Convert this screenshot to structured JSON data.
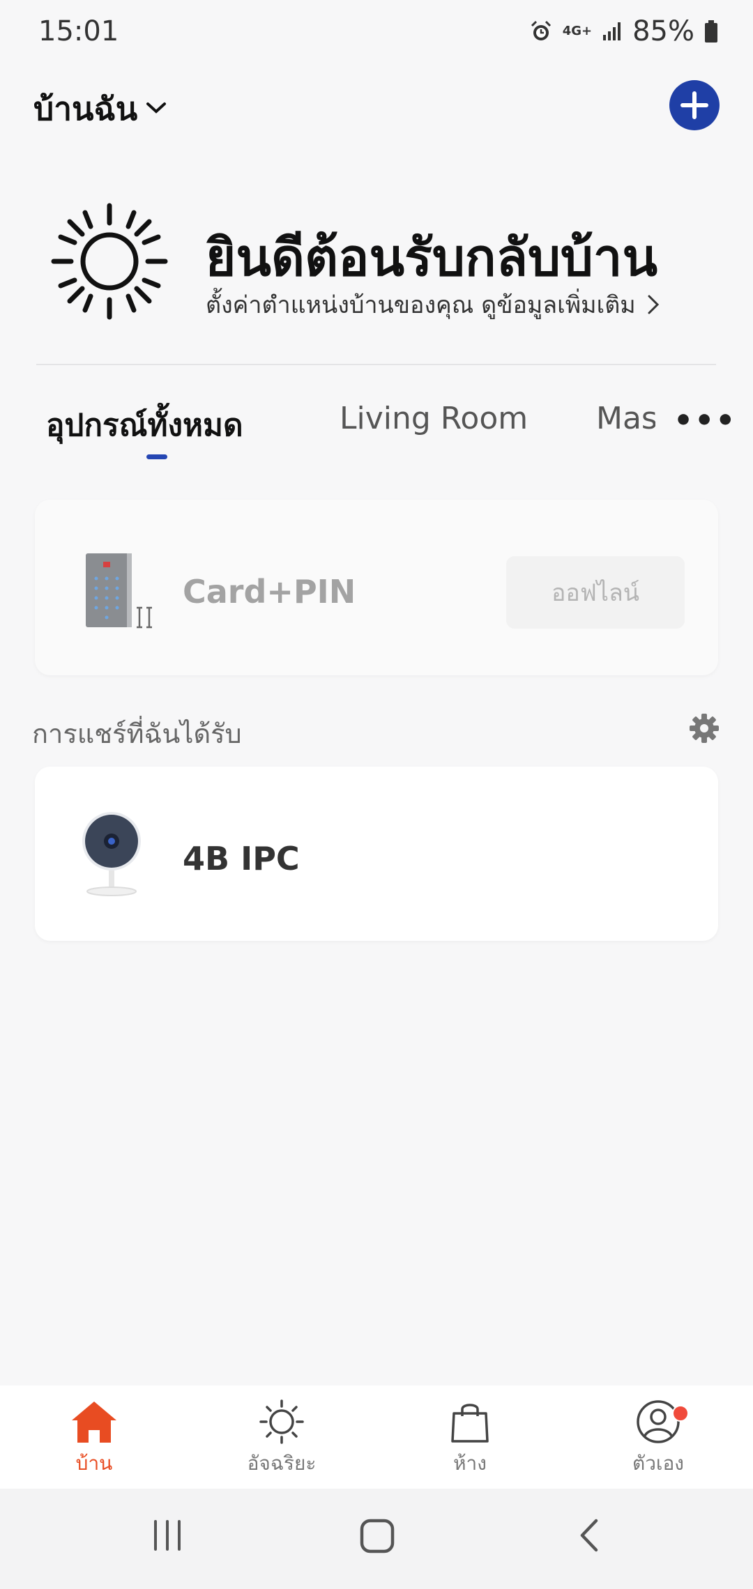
{
  "status_bar": {
    "time": "15:01",
    "network": "4G+",
    "battery": "85%",
    "icons": [
      "alarm-icon",
      "network-4g-icon",
      "signal-icon",
      "battery-icon"
    ]
  },
  "header": {
    "home_name": "บ้านฉัน",
    "add_icon": "plus-icon"
  },
  "welcome": {
    "title": "ยินดีต้อนรับกลับบ้าน",
    "subtitle": "ตั้งค่าตำแหน่งบ้านของคุณ ดูข้อมูลเพิ่มเติม"
  },
  "tabs": {
    "items": [
      {
        "label": "อุปกรณ์ทั้งหมด",
        "active": true
      },
      {
        "label": "Living Room",
        "active": false
      },
      {
        "label": "Master Bedroom",
        "active": false
      }
    ]
  },
  "devices": [
    {
      "name": "Card+PIN",
      "status": "ออฟไลน์",
      "icon": "keypad-icon"
    }
  ],
  "shared": {
    "title": "การแชร์ที่ฉันได้รับ",
    "devices": [
      {
        "name": "4B IPC",
        "icon": "camera-icon"
      }
    ]
  },
  "bottom_nav": [
    {
      "label": "บ้าน",
      "icon": "home-icon",
      "active": true
    },
    {
      "label": "อัจฉริยะ",
      "icon": "smart-sun-icon",
      "active": false
    },
    {
      "label": "ห้าง",
      "icon": "shopping-bag-icon",
      "active": false
    },
    {
      "label": "ตัวเอง",
      "icon": "profile-icon",
      "active": false,
      "badge": true
    }
  ],
  "colors": {
    "accent": "#1f3fa6",
    "tab_indicator": "#2546b3",
    "active_nav": "#e84c22",
    "badge": "#f04a3b",
    "background": "#f7f7f8"
  }
}
